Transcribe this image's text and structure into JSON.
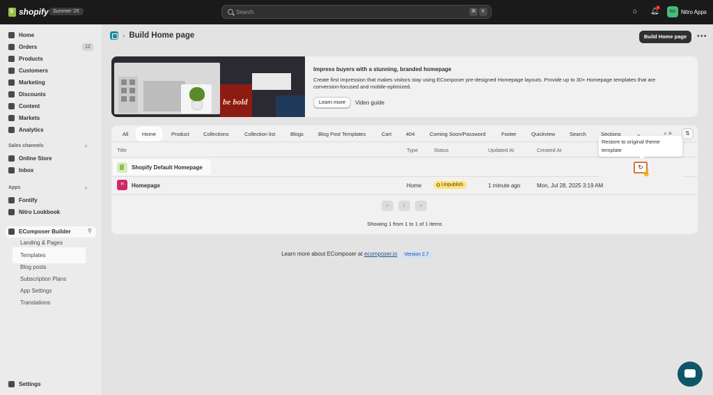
{
  "topbar": {
    "brand": "shopify",
    "edition": "Summer '25",
    "search_placeholder": "Search",
    "kbd1": "⌘",
    "kbd2": "K",
    "notif_count": "2",
    "avatar_initials": "NA",
    "store_name": "Nitro Apps"
  },
  "sidebar": {
    "items": [
      {
        "label": "Home"
      },
      {
        "label": "Orders",
        "count": "12"
      },
      {
        "label": "Products"
      },
      {
        "label": "Customers"
      },
      {
        "label": "Marketing"
      },
      {
        "label": "Discounts"
      },
      {
        "label": "Content"
      },
      {
        "label": "Markets"
      },
      {
        "label": "Analytics"
      }
    ],
    "sales_channels_label": "Sales channels",
    "sales_channels": [
      {
        "label": "Online Store"
      },
      {
        "label": "Inbox"
      }
    ],
    "apps_label": "Apps",
    "apps": [
      {
        "label": "Fontify"
      },
      {
        "label": "Nitro Lookbook"
      }
    ],
    "active_app": "EComposer Builder",
    "sub_items": [
      {
        "label": "Landing & Pages"
      },
      {
        "label": "Templates"
      },
      {
        "label": "Blog posts"
      },
      {
        "label": "Subscription Plans"
      },
      {
        "label": "App Settings"
      },
      {
        "label": "Translations"
      }
    ],
    "settings": "Settings"
  },
  "page": {
    "title": "Build Home page",
    "primary_button": "Build Home page",
    "more": "•••"
  },
  "banner": {
    "title": "Impress buyers with a stunning, branded homepage",
    "description": "Create first impression that makes visitors stay using EComposer pre-designed Homepage layouts. Provide up to 30+ Homepage templates that are conversion-focused and mobile-optimized.",
    "learn_more": "Learn more",
    "video_guide": "Video guide",
    "poster_text": "be bold"
  },
  "tabs": [
    "All",
    "Home",
    "Product",
    "Collections",
    "Collection list",
    "Blogs",
    "Blog Post Templates",
    "Cart",
    "404",
    "Coming Soon/Password",
    "Footer",
    "Quickview",
    "Search",
    "Sections"
  ],
  "table": {
    "headers": {
      "title": "Title",
      "type": "Type",
      "status": "Status",
      "updated": "Updated At",
      "created": "Created At"
    },
    "rows": [
      {
        "title": "Shopify Default Homepage"
      },
      {
        "icon": "H",
        "title": "Homepage",
        "type": "Home",
        "status": "Unpublish",
        "updated": "1 minute ago",
        "created": "Mon, Jul 28, 2025 3:19 AM"
      }
    ],
    "pager": {
      "prev": "«",
      "page": "1",
      "next": "»"
    },
    "showing": "Showing 1 from 1 to 1 of 1 items"
  },
  "tooltip": "Restore to original theme template",
  "footer": {
    "text": "Learn more about EComposer at",
    "link": "ecomposer.io",
    "version": "Version 2.7"
  },
  "colors": {
    "accent_highlight": "#e2703a",
    "badge": "#ffe27a",
    "chat": "#0f5568"
  }
}
